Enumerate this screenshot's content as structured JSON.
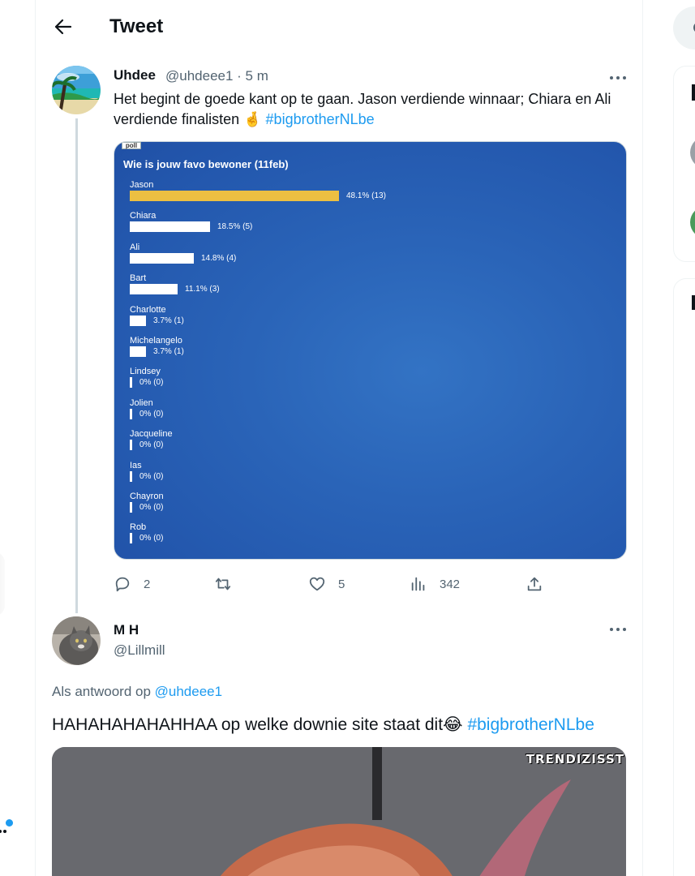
{
  "header": {
    "title": "Tweet",
    "back_icon": "arrow-left-icon"
  },
  "tweet": {
    "name": "Uhdee",
    "handle_time": "@uhdeee1 · 5 m",
    "text": "Het begint de goede kant op te gaan. Jason verdiende winnaar; Chiara en Ali verdiende finalisten ",
    "emoji": "🤞",
    "hashtag": "#bigbrotherNLbe",
    "poll_image": {
      "chip": "poll",
      "title": "Wie is jouw favo bewoner (11feb)",
      "rows": [
        {
          "name": "Jason",
          "label": "48.1% (13)",
          "fraction": 0.481,
          "lead": true
        },
        {
          "name": "Chiara",
          "label": "18.5% (5)",
          "fraction": 0.185
        },
        {
          "name": "Ali",
          "label": "14.8% (4)",
          "fraction": 0.148
        },
        {
          "name": "Bart",
          "label": "11.1% (3)",
          "fraction": 0.111
        },
        {
          "name": "Charlotte",
          "label": "3.7% (1)",
          "fraction": 0.037
        },
        {
          "name": "Michelangelo",
          "label": "3.7% (1)",
          "fraction": 0.037
        },
        {
          "name": "Lindsey",
          "label": "0% (0)",
          "fraction": 0
        },
        {
          "name": "Jolien",
          "label": "0% (0)",
          "fraction": 0
        },
        {
          "name": "Jacqueline",
          "label": "0% (0)",
          "fraction": 0
        },
        {
          "name": "Ias",
          "label": "0% (0)",
          "fraction": 0
        },
        {
          "name": "Chayron",
          "label": "0% (0)",
          "fraction": 0
        },
        {
          "name": "Rob",
          "label": "0% (0)",
          "fraction": 0
        }
      ]
    },
    "actions": {
      "replies": "2",
      "retweets": "",
      "likes": "5",
      "views": "342"
    }
  },
  "reply": {
    "name": "M H",
    "handle": "@Lillmill",
    "replying_to_prefix": "Als antwoord op",
    "replying_to_handle": "@uhdeee1",
    "text": "HAHAHAHAHAHHAA op welke downie site staat dit",
    "emoji": "😂",
    "hashtag": "#bigbrotherNLbe",
    "media_label": "TRENDIZISST"
  },
  "colors": {
    "accent": "#1d9bf0",
    "poll_bg": "#2a64b8",
    "poll_lead_bar": "#ecbf42"
  }
}
